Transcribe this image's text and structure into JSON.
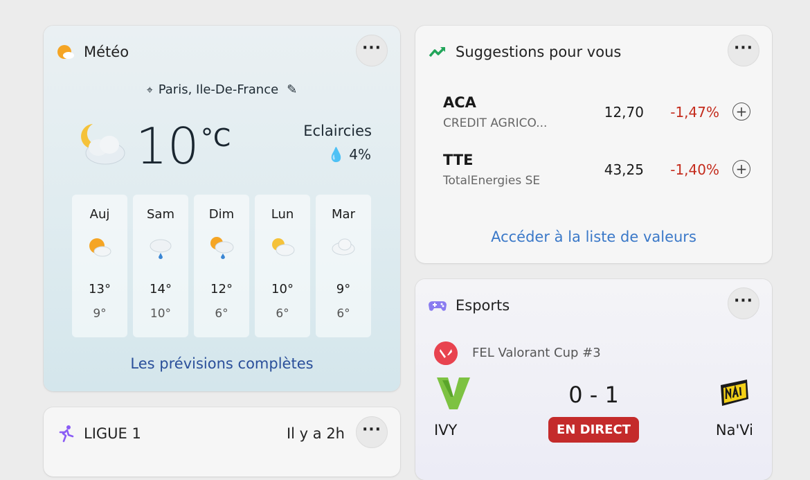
{
  "weather": {
    "title": "Météo",
    "location": "Paris, Ile-De-France",
    "temperature": "10",
    "unit": "°C",
    "condition": "Eclaircies",
    "precipitation": "4%",
    "days": [
      {
        "name": "Auj",
        "high": "13°",
        "low": "9°",
        "icon": "partly-sunny-icon"
      },
      {
        "name": "Sam",
        "high": "14°",
        "low": "10°",
        "icon": "rain-icon"
      },
      {
        "name": "Dim",
        "high": "12°",
        "low": "6°",
        "icon": "sun-rain-icon"
      },
      {
        "name": "Lun",
        "high": "10°",
        "low": "6°",
        "icon": "partly-sunny-icon"
      },
      {
        "name": "Mar",
        "high": "9°",
        "low": "6°",
        "icon": "cloudy-icon"
      }
    ],
    "forecast_link": "Les prévisions complètes"
  },
  "ligue": {
    "title": "LIGUE 1",
    "time": "Il y a 2h"
  },
  "stocks": {
    "title": "Suggestions pour vous",
    "items": [
      {
        "symbol": "ACA",
        "name": "CREDIT AGRICO...",
        "price": "12,70",
        "change": "-1,47%"
      },
      {
        "symbol": "TTE",
        "name": "TotalEnergies SE",
        "price": "43,25",
        "change": "-1,40%"
      }
    ],
    "link": "Accéder à la liste de valeurs",
    "negative_color": "#c42b1c"
  },
  "esports": {
    "title": "Esports",
    "tournament": "FEL Valorant Cup #3",
    "score": "0 - 1",
    "status": "EN DIRECT",
    "team1": "IVY",
    "team2": "Na'Vi"
  },
  "more_label": "···"
}
